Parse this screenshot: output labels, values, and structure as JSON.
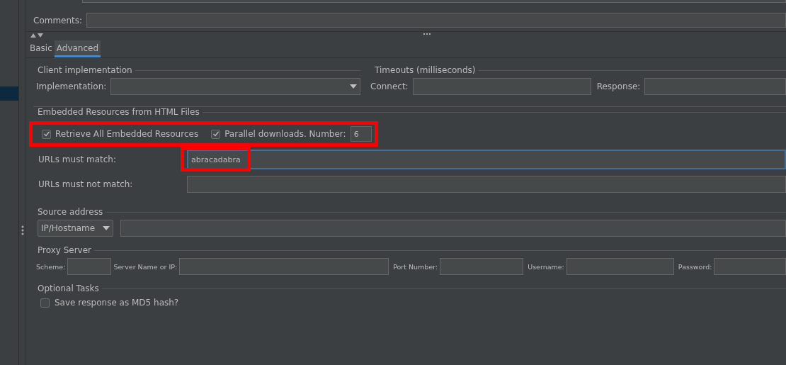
{
  "comments": {
    "label": "Comments:"
  },
  "tabs": [
    {
      "label": "Basic",
      "selected": false
    },
    {
      "label": "Advanced",
      "selected": true
    }
  ],
  "client_implementation": {
    "title": "Client implementation",
    "label": "Implementation:"
  },
  "timeouts": {
    "title": "Timeouts (milliseconds)",
    "connect_label": "Connect:",
    "response_label": "Response:"
  },
  "embedded_resources": {
    "title": "Embedded Resources from HTML Files",
    "retrieve_all": {
      "label": "Retrieve All Embedded Resources",
      "checked": true
    },
    "parallel_downloads": {
      "label": "Parallel downloads. Number:",
      "checked": true,
      "value": "6"
    },
    "urls_must_match": {
      "label": "URLs must match:",
      "value": "abracadabra",
      "focused": true
    },
    "urls_must_not_match": {
      "label": "URLs must not match:",
      "focused": false
    }
  },
  "source_address": {
    "title": "Source address",
    "type": "IP/Hostname"
  },
  "proxy_server": {
    "title": "Proxy Server",
    "fields": [
      {
        "label": "Scheme:"
      },
      {
        "label": "Server Name or IP:"
      },
      {
        "label": "Port Number:"
      },
      {
        "label": "Username:"
      },
      {
        "label": "Password:"
      }
    ]
  },
  "optional_tasks": {
    "title": "Optional Tasks",
    "md5": {
      "label": "Save response as MD5 hash?",
      "checked": false
    }
  }
}
